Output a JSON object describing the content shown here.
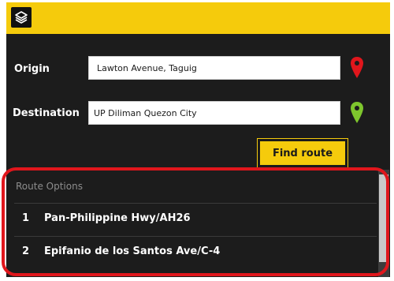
{
  "header": {
    "layers_icon": "layers-icon",
    "accent": "#f5cb0c"
  },
  "form": {
    "origin_label": "Origin",
    "origin_value": "Lawton Avenue, Taguig",
    "origin_pin_color": "#e0161c",
    "destination_label": "Destination",
    "destination_value": "UP Diliman Quezon City",
    "destination_pin_color": "#7ec62d",
    "find_route_label": "Find route"
  },
  "routes": {
    "title": "Route Options",
    "items": [
      {
        "num": "1",
        "name": "Pan-Philippine Hwy/AH26"
      },
      {
        "num": "2",
        "name": "Epifanio de los Santos Ave/C-4"
      }
    ]
  },
  "highlight_color": "#e0161c"
}
